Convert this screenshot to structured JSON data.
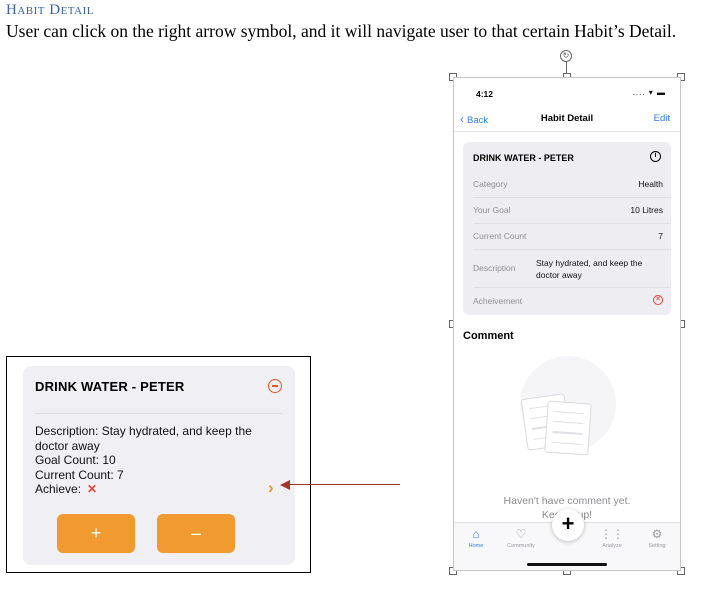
{
  "doc": {
    "heading": "Habit Detail",
    "paragraph": "User can click on the right arrow symbol, and it will navigate user to that certain Habit’s Detail."
  },
  "card": {
    "title": "DRINK WATER - PETER",
    "description_line1": "Description: Stay hydrated, and keep the",
    "description_line2": "doctor away",
    "goal": "Goal Count: 10",
    "current": "Current Count: 7",
    "achieve_label": "Achieve:",
    "achieve_mark": "✕",
    "chevron": "›",
    "plus": "+",
    "minus": "–",
    "accent": "#f09a2f"
  },
  "phone": {
    "status_time": "4:12",
    "status_icons": "....  ▾  ▬",
    "back_label": "Back",
    "nav_title": "Habit Detail",
    "edit_label": "Edit",
    "habit_title": "DRINK WATER - PETER",
    "rows": [
      {
        "label": "Category",
        "value": "Health"
      },
      {
        "label": "Your Goal",
        "value": "10 Litres"
      },
      {
        "label": "Current Count",
        "value": "7"
      },
      {
        "label": "Description",
        "value_line1": "Stay hydrated, and keep the",
        "value_line2": "doctor away"
      },
      {
        "label": "Acheivement",
        "value": "✕"
      }
    ],
    "comment_title": "Comment",
    "empty_line1": "Haven't have comment yet.",
    "empty_line2": "Keep it up!",
    "tabs": [
      {
        "label": "Home",
        "icon": "home-icon"
      },
      {
        "label": "Community",
        "icon": "heart-icon"
      },
      {
        "label": "Analyze",
        "icon": "waveform-icon"
      },
      {
        "label": "Setting",
        "icon": "gear-icon"
      }
    ],
    "fab_label": "+",
    "link_color": "#2f7cf6"
  }
}
